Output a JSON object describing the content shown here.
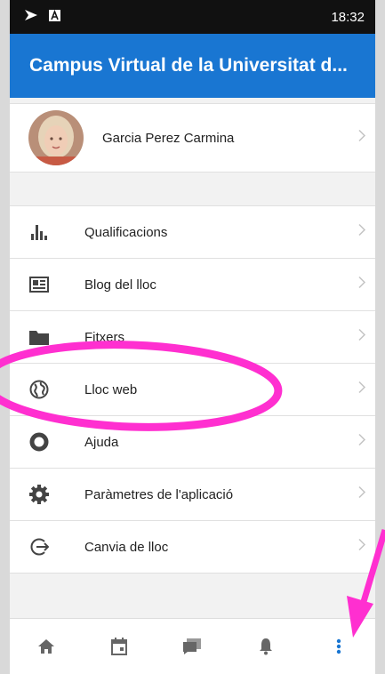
{
  "status_bar": {
    "time": "18:32"
  },
  "app_bar": {
    "title": "Campus Virtual de la Universitat d..."
  },
  "user": {
    "name": "Garcia Perez Carmina"
  },
  "menu": [
    {
      "label": "Qualificacions",
      "icon": "bar-chart-icon"
    },
    {
      "label": "Blog del lloc",
      "icon": "newspaper-icon"
    },
    {
      "label": "Fitxers",
      "icon": "folder-icon"
    },
    {
      "label": "Lloc web",
      "icon": "globe-icon"
    },
    {
      "label": "Ajuda",
      "icon": "lifebuoy-icon"
    },
    {
      "label": "Paràmetres de l'aplicació",
      "icon": "gear-icon"
    },
    {
      "label": "Canvia de lloc",
      "icon": "logout-icon"
    }
  ],
  "bottom_nav": [
    "home-icon",
    "calendar-icon",
    "messages-icon",
    "bell-icon",
    "more-icon"
  ],
  "colors": {
    "accent": "#1976d2",
    "annotation": "#ff2fd0"
  }
}
